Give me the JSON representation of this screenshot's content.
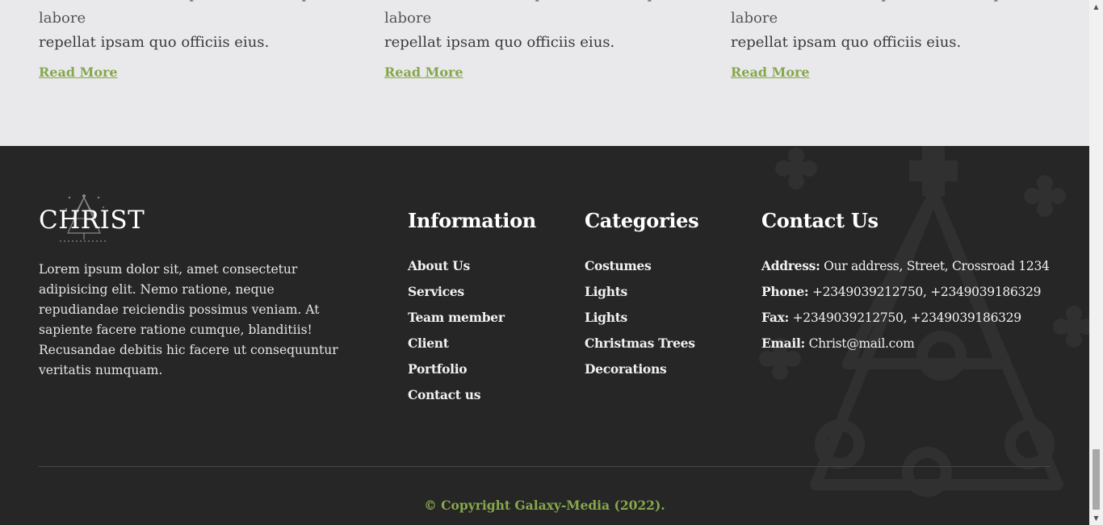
{
  "blog": {
    "posts": [
      {
        "cut_text": "ratione incidunt et aperiam sint corporis labore",
        "text": "repellat ipsam quo officiis eius.",
        "read_more": "Read More"
      },
      {
        "cut_text": "ratione incidunt et aperiam sint corporis labore",
        "text": "repellat ipsam quo officiis eius.",
        "read_more": "Read More"
      },
      {
        "cut_text": "ratione incidunt et aperiam sint corporis labore",
        "text": "repellat ipsam quo officiis eius.",
        "read_more": "Read More"
      }
    ]
  },
  "footer": {
    "brand": "CHRIST",
    "about": "Lorem ipsum dolor sit, amet consectetur adipisicing elit. Nemo ratione, neque repudiandae reiciendis possimus veniam. At sapiente facere ratione cumque, blanditiis! Recusandae debitis hic facere ut consequuntur veritatis numquam.",
    "information": {
      "title": "Information",
      "links": [
        "About Us",
        "Services",
        "Team member",
        "Client",
        "Portfolio",
        "Contact us"
      ]
    },
    "categories": {
      "title": "Categories",
      "links": [
        "Costumes",
        "Lights",
        "Lights",
        "Christmas Trees",
        "Decorations"
      ]
    },
    "contact": {
      "title": "Contact Us",
      "items": [
        {
          "label": "Address:",
          "value": "Our address, Street, Crossroad 1234"
        },
        {
          "label": "Phone:",
          "value": "+2349039212750, +2349039186329"
        },
        {
          "label": "Fax:",
          "value": "+2349039212750, +2349039186329"
        },
        {
          "label": "Email:",
          "value": "Christ@mail.com"
        }
      ]
    },
    "copyright": "© Copyright Galaxy-Media (2022)."
  },
  "scrollbar": {
    "up_icon": "▲",
    "down_icon": "▼"
  },
  "colors": {
    "accent": "#86a74b",
    "footer_bg": "#262626",
    "page_bg": "#e9e9ec"
  }
}
